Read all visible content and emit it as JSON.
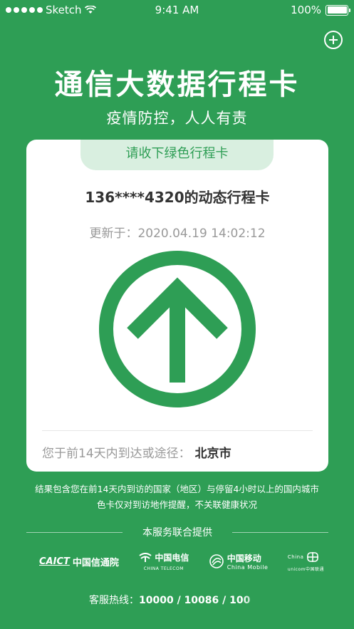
{
  "status_bar": {
    "carrier": "Sketch",
    "time": "9:41 AM",
    "battery": "100%"
  },
  "header": {
    "title": "通信大数据行程卡",
    "subtitle": "疫情防控，人人有责",
    "add_icon": "plus-circle-icon"
  },
  "card": {
    "tab_label": "请收下绿色行程卡",
    "phone_title": "136****4320的动态行程卡",
    "update_label": "更新于：",
    "update_time": "2020.04.19 14:02:12",
    "status_icon": "up-arrow-circle-icon",
    "status_color": "#2e9e55",
    "route_label": "您于前14天内到达或途径：",
    "route_city": "北京市"
  },
  "note": {
    "line1": "结果包含您在前14天内到访的国家（地区）与停留4小时以上的国内城市",
    "line2": "色卡仅对到访地作提醒，不关联健康状况"
  },
  "providers": {
    "heading": "本服务联合提供",
    "caict_en": "CAICT",
    "caict_cn": "中国信通院",
    "telecom_cn": "中国电信",
    "telecom_en": "CHINA TELECOM",
    "mobile_cn": "中国移动",
    "mobile_en": "China Mobile",
    "unicom_en": "China",
    "unicom_sub": "unicom中国联通"
  },
  "hotline": {
    "label": "客服热线：",
    "numbers": "10000 / 10086 / 100"
  },
  "colors": {
    "background": "#2e9e55",
    "card": "#ffffff",
    "tab": "#d9efe0"
  }
}
